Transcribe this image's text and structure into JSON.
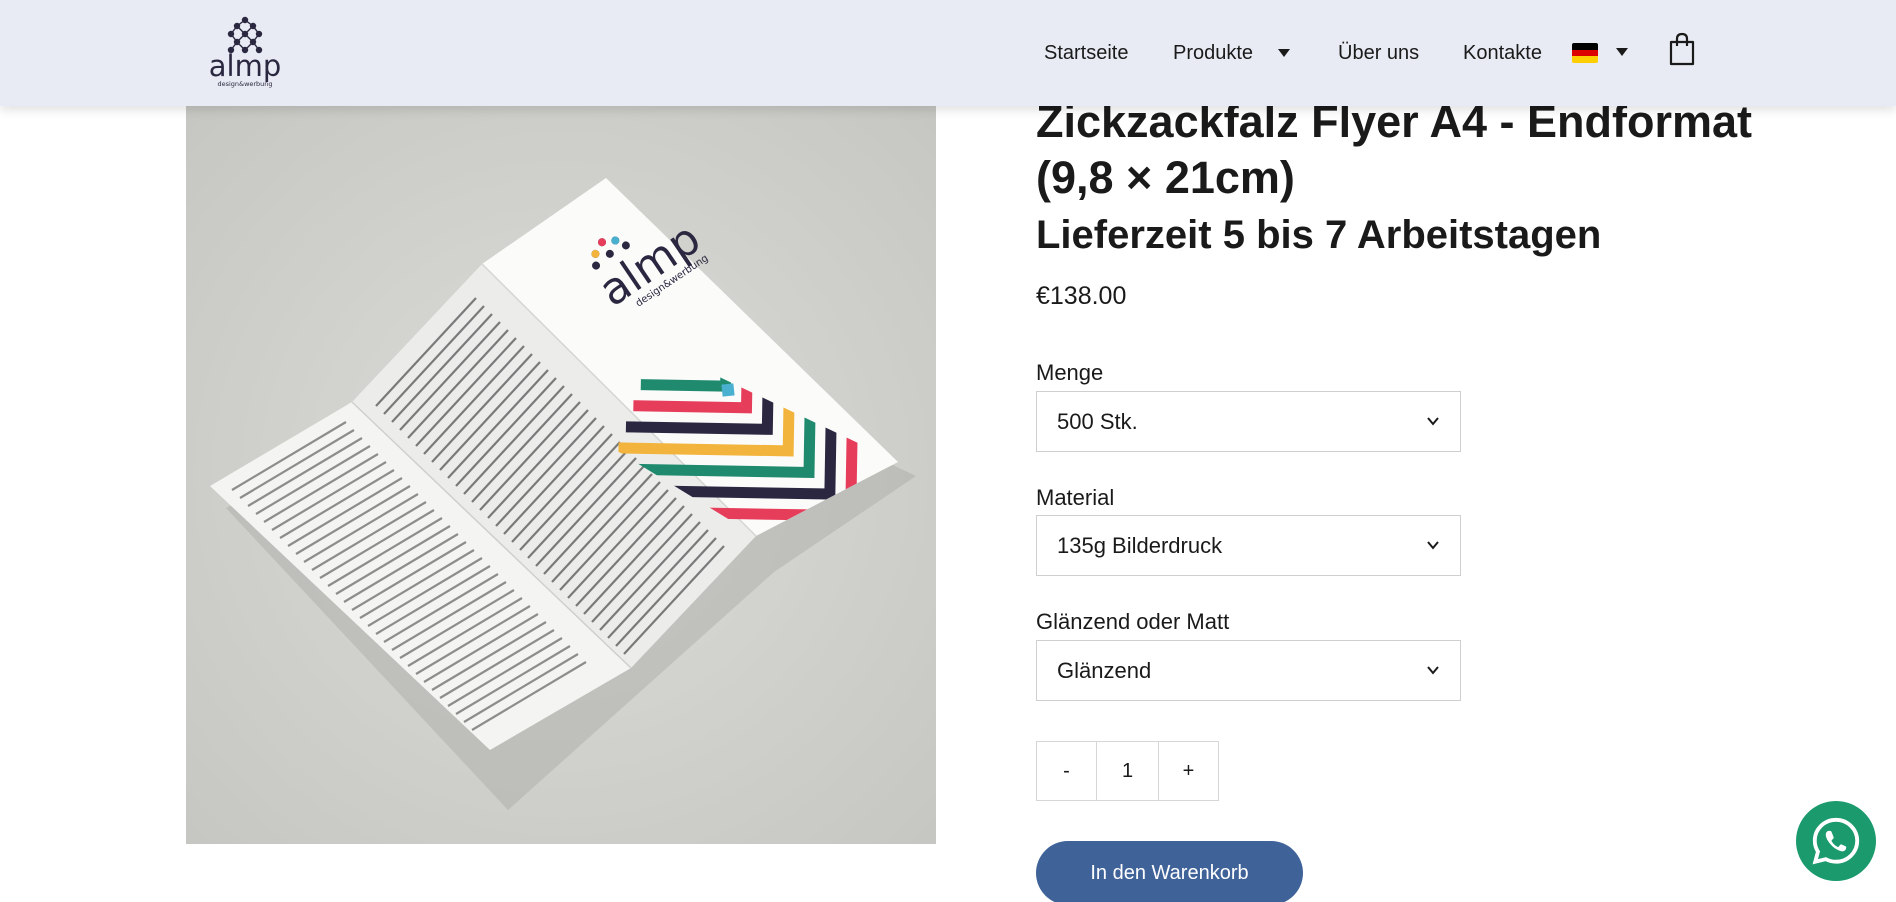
{
  "header": {
    "logo": {
      "text": "almp",
      "tagline": "design&werbung"
    },
    "nav": {
      "home": "Startseite",
      "products": "Produkte",
      "about": "Über uns",
      "contact": "Kontakte"
    },
    "language": {
      "flag": "de-flag-icon"
    },
    "cart_icon": "shopping-bag-icon"
  },
  "product": {
    "title": "Zickzackfalz Flyer A4 - Endformat (9,8 × 21cm)",
    "delivery": "Lieferzeit 5 bis 7 Arbeitstagen",
    "price": "€138.00",
    "image_brand": {
      "text": "almp",
      "tagline": "design&werbung"
    }
  },
  "options": {
    "quantity": {
      "label": "Menge",
      "value": "500 Stk."
    },
    "material": {
      "label": "Material",
      "value": "135g Bilderdruck"
    },
    "finish": {
      "label": "Glänzend oder Matt",
      "value": "Glänzend"
    }
  },
  "qty_stepper": {
    "minus": "-",
    "value": "1",
    "plus": "+"
  },
  "add_to_cart": "In den Warenkorb",
  "colors": {
    "header_bg": "#e8ebf3",
    "button": "#3f6298",
    "whatsapp": "#1a9a6d"
  }
}
